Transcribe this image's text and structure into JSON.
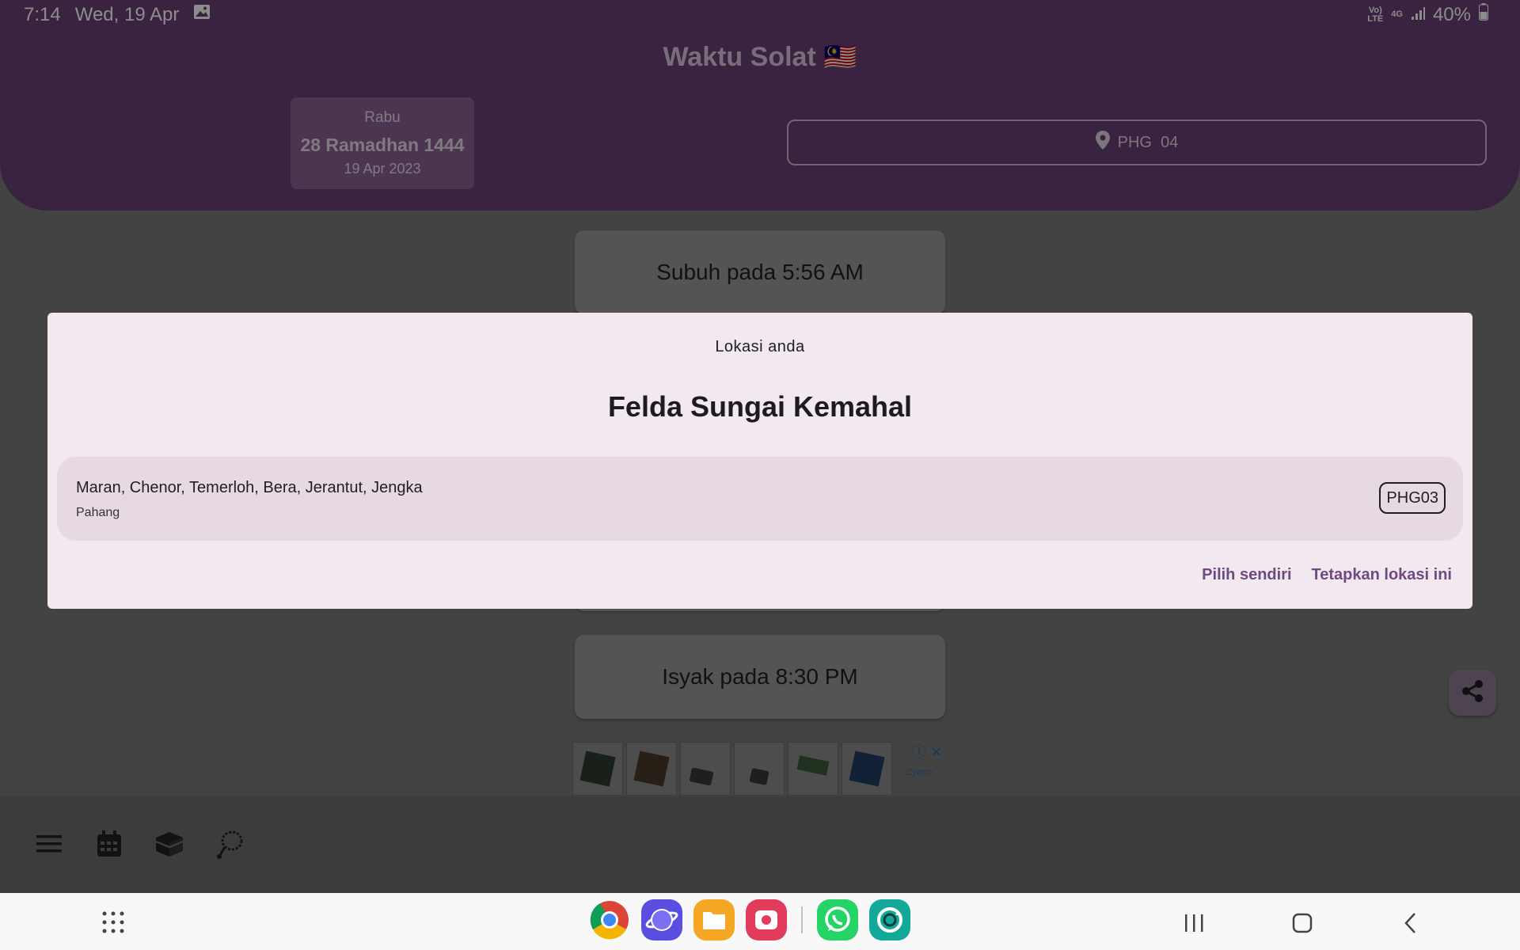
{
  "status_bar": {
    "time": "7:14",
    "date": "Wed, 19 Apr",
    "network_top": "Vo)",
    "network_bottom": "LTE",
    "signal_label": "4G",
    "battery": "40%"
  },
  "header": {
    "title": "Waktu Solat 🇲🇾",
    "date_card": {
      "day": "Rabu",
      "hijri": "28 Ramadhan 1444",
      "gregorian": "19 Apr 2023"
    },
    "location_button": {
      "icon": "location-pin-icon",
      "label": "PHG  04"
    }
  },
  "prayers": [
    {
      "label": "Subuh pada 5:56 AM"
    },
    {
      "label": "Isyak pada 8:30 PM"
    }
  ],
  "dialog": {
    "subtitle": "Lokasi anda",
    "title": "Felda Sungai Kemahal",
    "zone": {
      "name": "Maran, Chenor, Temerloh, Bera, Jerantut, Jengka",
      "state": "Pahang",
      "code": "PHG03"
    },
    "actions": {
      "secondary": "Pilih sendiri",
      "primary": "Tetapkan lokasi ini"
    }
  },
  "ad": {
    "logo_text": "Cytron"
  },
  "bottom_nav": {
    "icons": [
      "menu-icon",
      "calendar-icon",
      "kaaba-icon",
      "tasbih-icon"
    ]
  },
  "fab": {
    "icon": "share-icon"
  },
  "system_nav": {
    "dock_apps": [
      "chrome-icon",
      "samsung-internet-icon",
      "my-files-icon",
      "screen-recorder-icon",
      "whatsapp-icon",
      "refresh-app-icon"
    ],
    "buttons": [
      "recents-icon",
      "home-icon",
      "back-icon"
    ]
  },
  "colors": {
    "header": "#6b3e77",
    "dialog_bg": "#f2e8ef",
    "zone_tile": "#e6d9e3",
    "accent": "#6e4a80"
  }
}
